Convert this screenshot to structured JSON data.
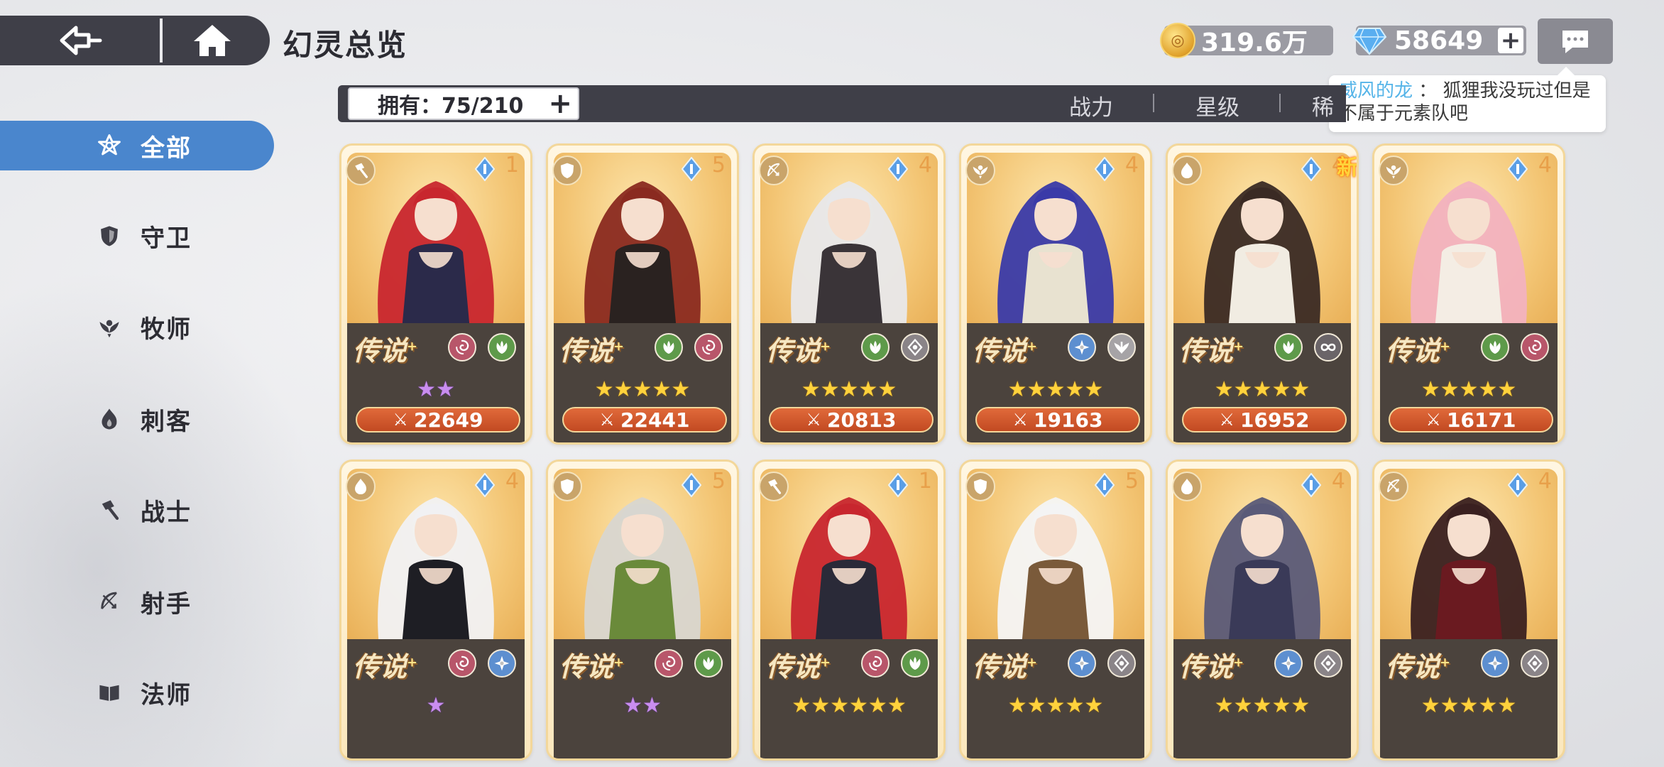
{
  "header": {
    "title": "幻灵总览",
    "gold_amount": "319.6万",
    "gem_amount": "58649"
  },
  "chat": {
    "sender": "威风的龙",
    "separator": "：",
    "message": "狐狸我没玩过但是不属于元素队吧"
  },
  "filter": {
    "owned": "拥有：75/210",
    "sort_options": [
      "战力",
      "星级",
      "稀"
    ]
  },
  "sidebar": {
    "items": [
      {
        "label": "全部",
        "icon": "all-star-icon"
      },
      {
        "label": "守卫",
        "icon": "shield-icon"
      },
      {
        "label": "牧师",
        "icon": "priest-wings-icon"
      },
      {
        "label": "刺客",
        "icon": "assassin-flame-icon"
      },
      {
        "label": "战士",
        "icon": "warrior-hammer-icon"
      },
      {
        "label": "射手",
        "icon": "archer-bow-icon"
      },
      {
        "label": "法师",
        "icon": "mage-book-icon"
      }
    ]
  },
  "rarity_label": "传说",
  "new_label": "新",
  "cards": [
    {
      "cost": "1",
      "class_icon": "warrior-hammer-icon",
      "elements": [
        "wind-swirl-icon",
        "nature-leaf-icon"
      ],
      "stars": 2,
      "star_color": "purple",
      "power": "22649",
      "hair": "#c8262e",
      "accent": "#2b2a4a"
    },
    {
      "cost": "5",
      "class_icon": "shield-icon",
      "elements": [
        "nature-leaf-icon",
        "wind-swirl-icon"
      ],
      "stars": 5,
      "star_color": "gold",
      "power": "22441",
      "hair": "#8a2a20",
      "accent": "#2a2220"
    },
    {
      "cost": "4",
      "class_icon": "archer-bow-icon",
      "elements": [
        "nature-leaf-icon",
        "light-diamond-icon"
      ],
      "stars": 5,
      "star_color": "gold",
      "power": "20813",
      "hair": "#e8e8ea",
      "accent": "#3a3438"
    },
    {
      "cost": "4",
      "class_icon": "priest-wings-icon",
      "elements": [
        "ice-snowflake-icon",
        "wings-icon"
      ],
      "stars": 5,
      "star_color": "gold",
      "power": "19163",
      "hair": "#3a3aa8",
      "accent": "#e8e2d0"
    },
    {
      "cost": "4",
      "class_icon": "assassin-flame-icon",
      "elements": [
        "nature-leaf-icon",
        "infinity-icon"
      ],
      "stars": 5,
      "star_color": "gold",
      "power": "16952",
      "hair": "#3a2a24",
      "accent": "#f1ece2",
      "is_new": true
    },
    {
      "cost": "4",
      "class_icon": "priest-wings-icon",
      "elements": [
        "nature-leaf-icon",
        "wind-swirl-icon"
      ],
      "stars": 5,
      "star_color": "gold",
      "power": "16171",
      "hair": "#f2b2bf",
      "accent": "#f4ede4"
    },
    {
      "cost": "4",
      "class_icon": "assassin-flame-icon",
      "elements": [
        "wind-swirl-icon",
        "ice-snowflake-icon"
      ],
      "stars": 1,
      "star_color": "purple",
      "power": "",
      "hair": "#f1f1f3",
      "accent": "#1e1e24"
    },
    {
      "cost": "5",
      "class_icon": "shield-icon",
      "elements": [
        "wind-swirl-icon",
        "nature-leaf-icon"
      ],
      "stars": 2,
      "star_color": "purple",
      "power": "",
      "hair": "#d8d6d0",
      "accent": "#6a8a3a"
    },
    {
      "cost": "1",
      "class_icon": "warrior-hammer-icon",
      "elements": [
        "wind-swirl-icon",
        "nature-leaf-icon"
      ],
      "stars": 6,
      "star_color": "gold",
      "power": "",
      "hair": "#c8262e",
      "accent": "#2a2a38"
    },
    {
      "cost": "5",
      "class_icon": "shield-icon",
      "elements": [
        "ice-snowflake-icon",
        "light-diamond-icon"
      ],
      "stars": 5,
      "star_color": "gold",
      "power": "",
      "hair": "#f4f4f4",
      "accent": "#7a5a3a"
    },
    {
      "cost": "4",
      "class_icon": "assassin-flame-icon",
      "elements": [
        "ice-snowflake-icon",
        "light-diamond-icon"
      ],
      "stars": 5,
      "star_color": "gold",
      "power": "",
      "hair": "#5a5a78",
      "accent": "#3a3a58"
    },
    {
      "cost": "4",
      "class_icon": "archer-bow-icon",
      "elements": [
        "ice-snowflake-icon",
        "light-diamond-icon"
      ],
      "stars": 5,
      "star_color": "gold",
      "power": "",
      "hair": "#3a2020",
      "accent": "#6a1a20"
    }
  ]
}
